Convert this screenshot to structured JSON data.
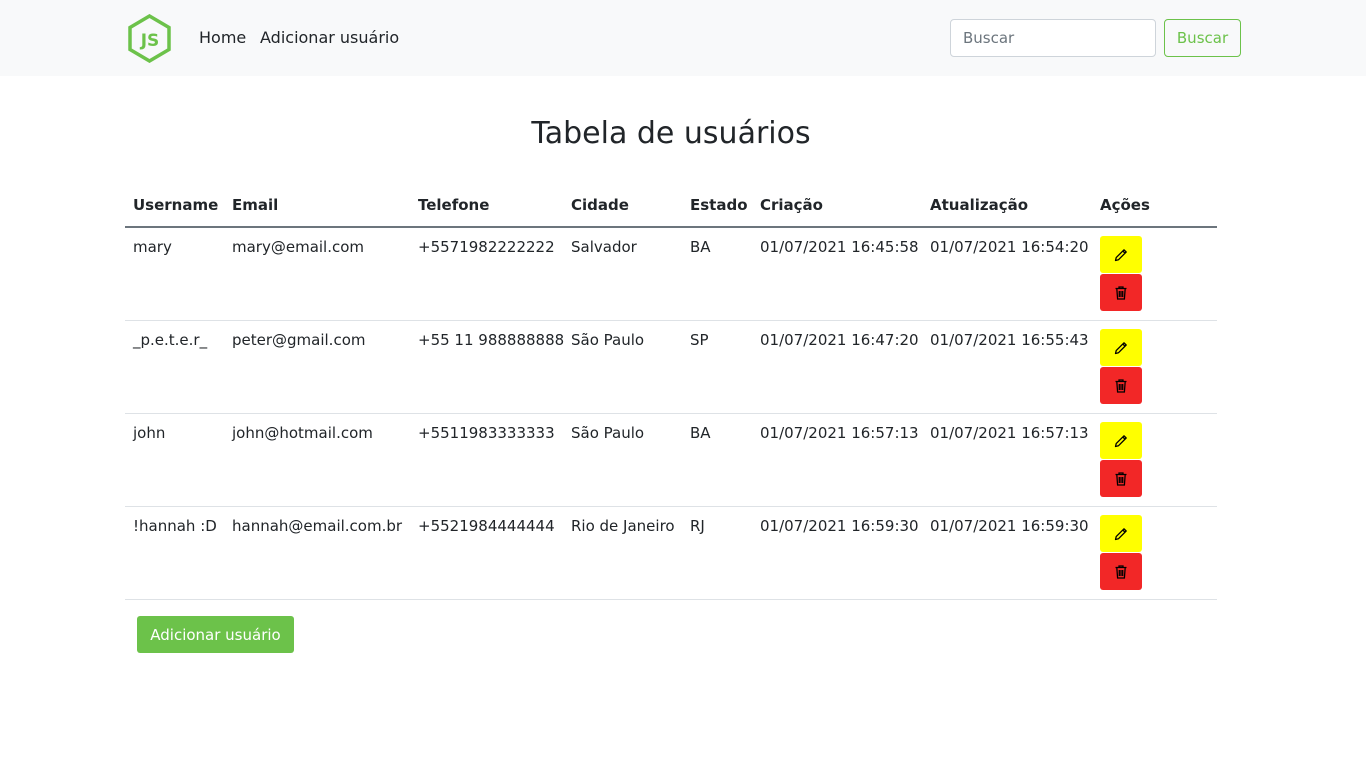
{
  "navbar": {
    "logo_text": "JS",
    "links": [
      "Home",
      "Adicionar usuário"
    ],
    "search_placeholder": "Buscar",
    "search_button": "Buscar"
  },
  "page": {
    "title": "Tabela de usuários"
  },
  "table": {
    "headers": [
      "Username",
      "Email",
      "Telefone",
      "Cidade",
      "Estado",
      "Criação",
      "Atualização",
      "Ações"
    ],
    "rows": [
      [
        "mary",
        "mary@email.com",
        "+5571982222222",
        "Salvador",
        "BA",
        "01/07/2021 16:45:58",
        "01/07/2021 16:54:20"
      ],
      [
        "_p.e.t.e.r_",
        "peter@gmail.com",
        "+55 11 988888888",
        "São Paulo",
        "SP",
        "01/07/2021 16:47:20",
        "01/07/2021 16:55:43"
      ],
      [
        "john",
        "john@hotmail.com",
        "+5511983333333",
        "São Paulo",
        "BA",
        "01/07/2021 16:57:13",
        "01/07/2021 16:57:13"
      ],
      [
        "!hannah :D",
        "hannah@email.com.br",
        "+5521984444444",
        "Rio de Janeiro",
        "RJ",
        "01/07/2021 16:59:30",
        "01/07/2021 16:59:30"
      ]
    ],
    "edit_icon": "pencil-icon",
    "delete_icon": "trash-icon"
  },
  "footer": {
    "add_button": "Adicionar usuário"
  },
  "colors": {
    "accent": "#6cc24a",
    "edit": "#ffff00",
    "delete": "#f22727",
    "navbar_bg": "#f8f9fa"
  }
}
